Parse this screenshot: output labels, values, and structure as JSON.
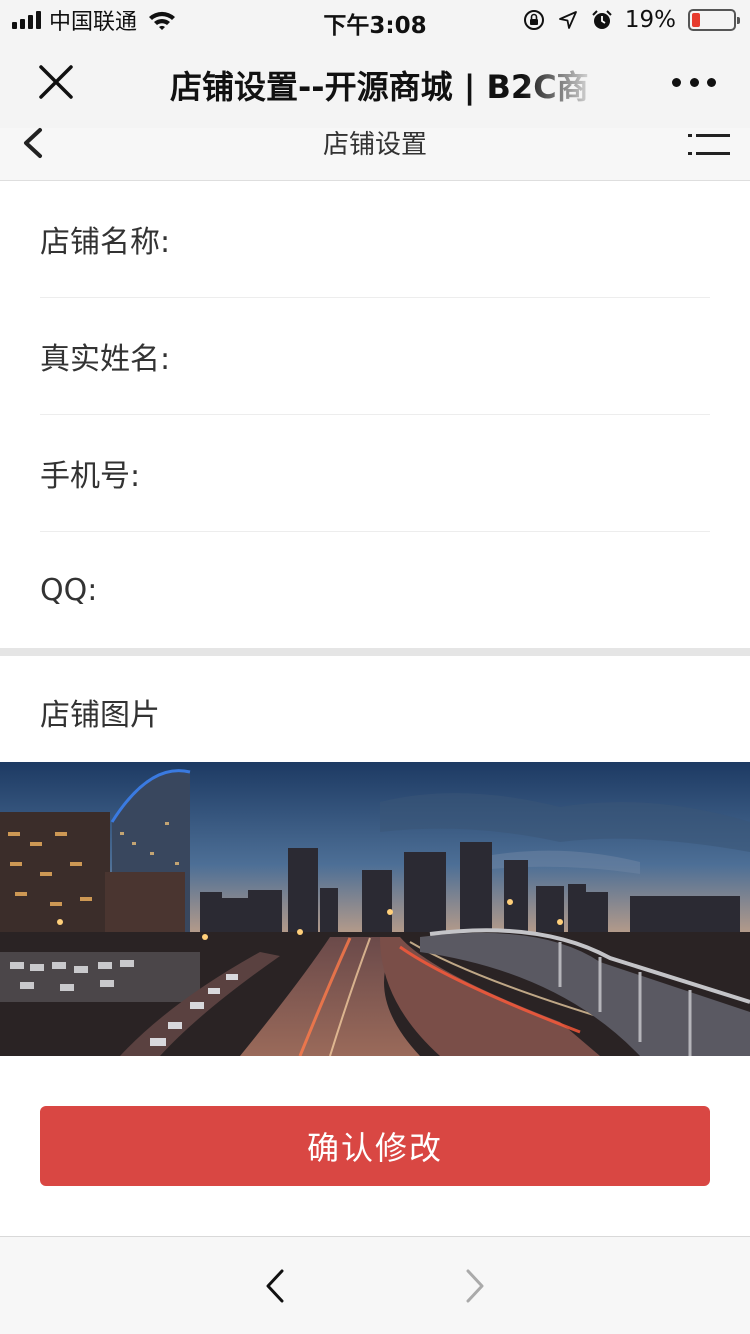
{
  "status_bar": {
    "carrier": "中国联通",
    "time": "下午3:08",
    "battery_percent": "19%",
    "battery_level": 0.19,
    "icons": [
      "signal-icon",
      "wifi-icon",
      "orientation-lock-icon",
      "location-icon",
      "alarm-icon",
      "battery-icon"
    ]
  },
  "browser": {
    "title": "店铺设置--开源商城 | B2C商",
    "close_icon": "close-icon",
    "more_icon": "more-icon"
  },
  "page_header": {
    "title": "店铺设置",
    "back_icon": "chevron-left-icon",
    "menu_icon": "menu-icon"
  },
  "form": {
    "fields": [
      {
        "label": "店铺名称:",
        "value": ""
      },
      {
        "label": "真实姓名:",
        "value": ""
      },
      {
        "label": "手机号:",
        "value": ""
      },
      {
        "label": "QQ:",
        "value": ""
      }
    ]
  },
  "shop_image": {
    "title": "店铺图片"
  },
  "actions": {
    "confirm_label": "确认修改"
  },
  "colors": {
    "accent": "#d94743",
    "battery_low": "#e63b2e"
  },
  "bottom_bar": {
    "back_icon": "chevron-left-icon",
    "forward_icon": "chevron-right-icon"
  }
}
